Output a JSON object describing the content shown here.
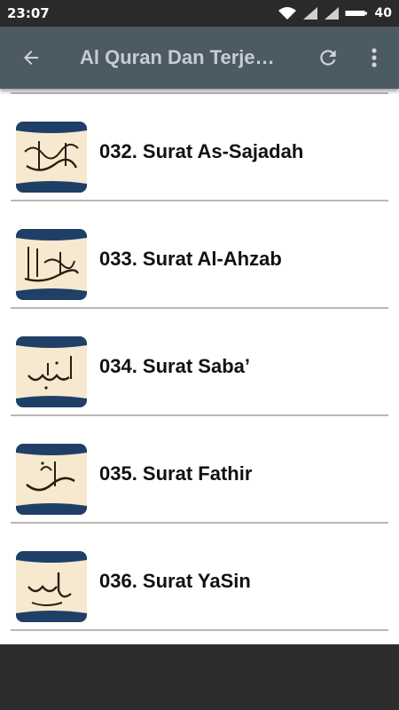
{
  "status_bar": {
    "time": "23:07",
    "battery": "40"
  },
  "app_bar": {
    "title": "Al Quran Dan Terjemahan",
    "back_icon": "arrow-left-icon",
    "refresh_icon": "refresh-icon",
    "menu_icon": "more-vert-icon"
  },
  "surahs": [
    {
      "label": "032. Surat As-Sajadah"
    },
    {
      "label": "033. Surat Al-Ahzab"
    },
    {
      "label": "034. Surat Saba’"
    },
    {
      "label": "035. Surat Fathir"
    },
    {
      "label": "036. Surat YaSin"
    }
  ],
  "colors": {
    "app_bar": "#4b5a63",
    "status_bar": "#2a2a2a",
    "icon_frame": "#1f3f66",
    "icon_parchment": "#f6e9cf"
  }
}
